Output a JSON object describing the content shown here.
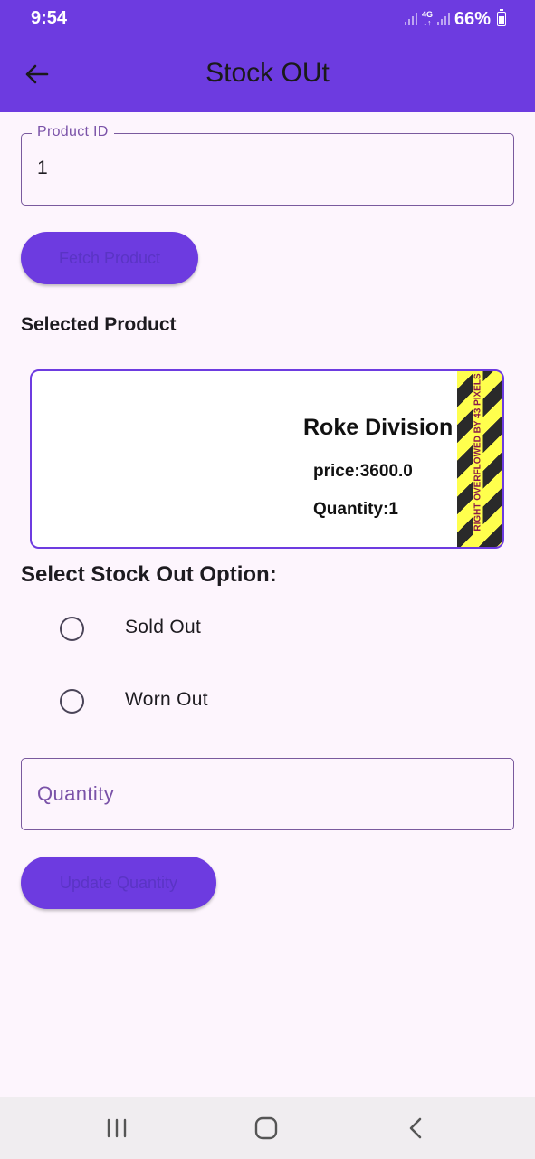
{
  "status_bar": {
    "time": "9:54",
    "network": "4G",
    "battery": "66%"
  },
  "app_bar": {
    "title": "Stock OUt",
    "back_icon": "arrow-back-icon"
  },
  "product_id_field": {
    "label": "Product ID",
    "value": "1"
  },
  "fetch_button": {
    "label": "Fetch Product"
  },
  "selected_product": {
    "heading": "Selected Product",
    "name": "Roke Division in Tech",
    "price": "price:3600.0",
    "quantity": "Quantity:1",
    "overflow_warning": "RIGHT OVERFLOWED BY 43 PIXELS"
  },
  "stock_out_options": {
    "heading": "Select Stock Out Option:",
    "options": [
      {
        "label": "Sold Out",
        "selected": false
      },
      {
        "label": "Worn Out",
        "selected": false
      }
    ]
  },
  "quantity_field": {
    "placeholder": "Quantity",
    "value": ""
  },
  "update_button": {
    "label": "Update Quantity"
  },
  "colors": {
    "primary": "#6d3be0",
    "background": "#fdf5fd",
    "outline": "#7a5a9e",
    "label": "#7a52a8"
  },
  "nav_bar": {
    "icons": [
      "recent-apps-icon",
      "home-icon",
      "back-icon"
    ]
  }
}
